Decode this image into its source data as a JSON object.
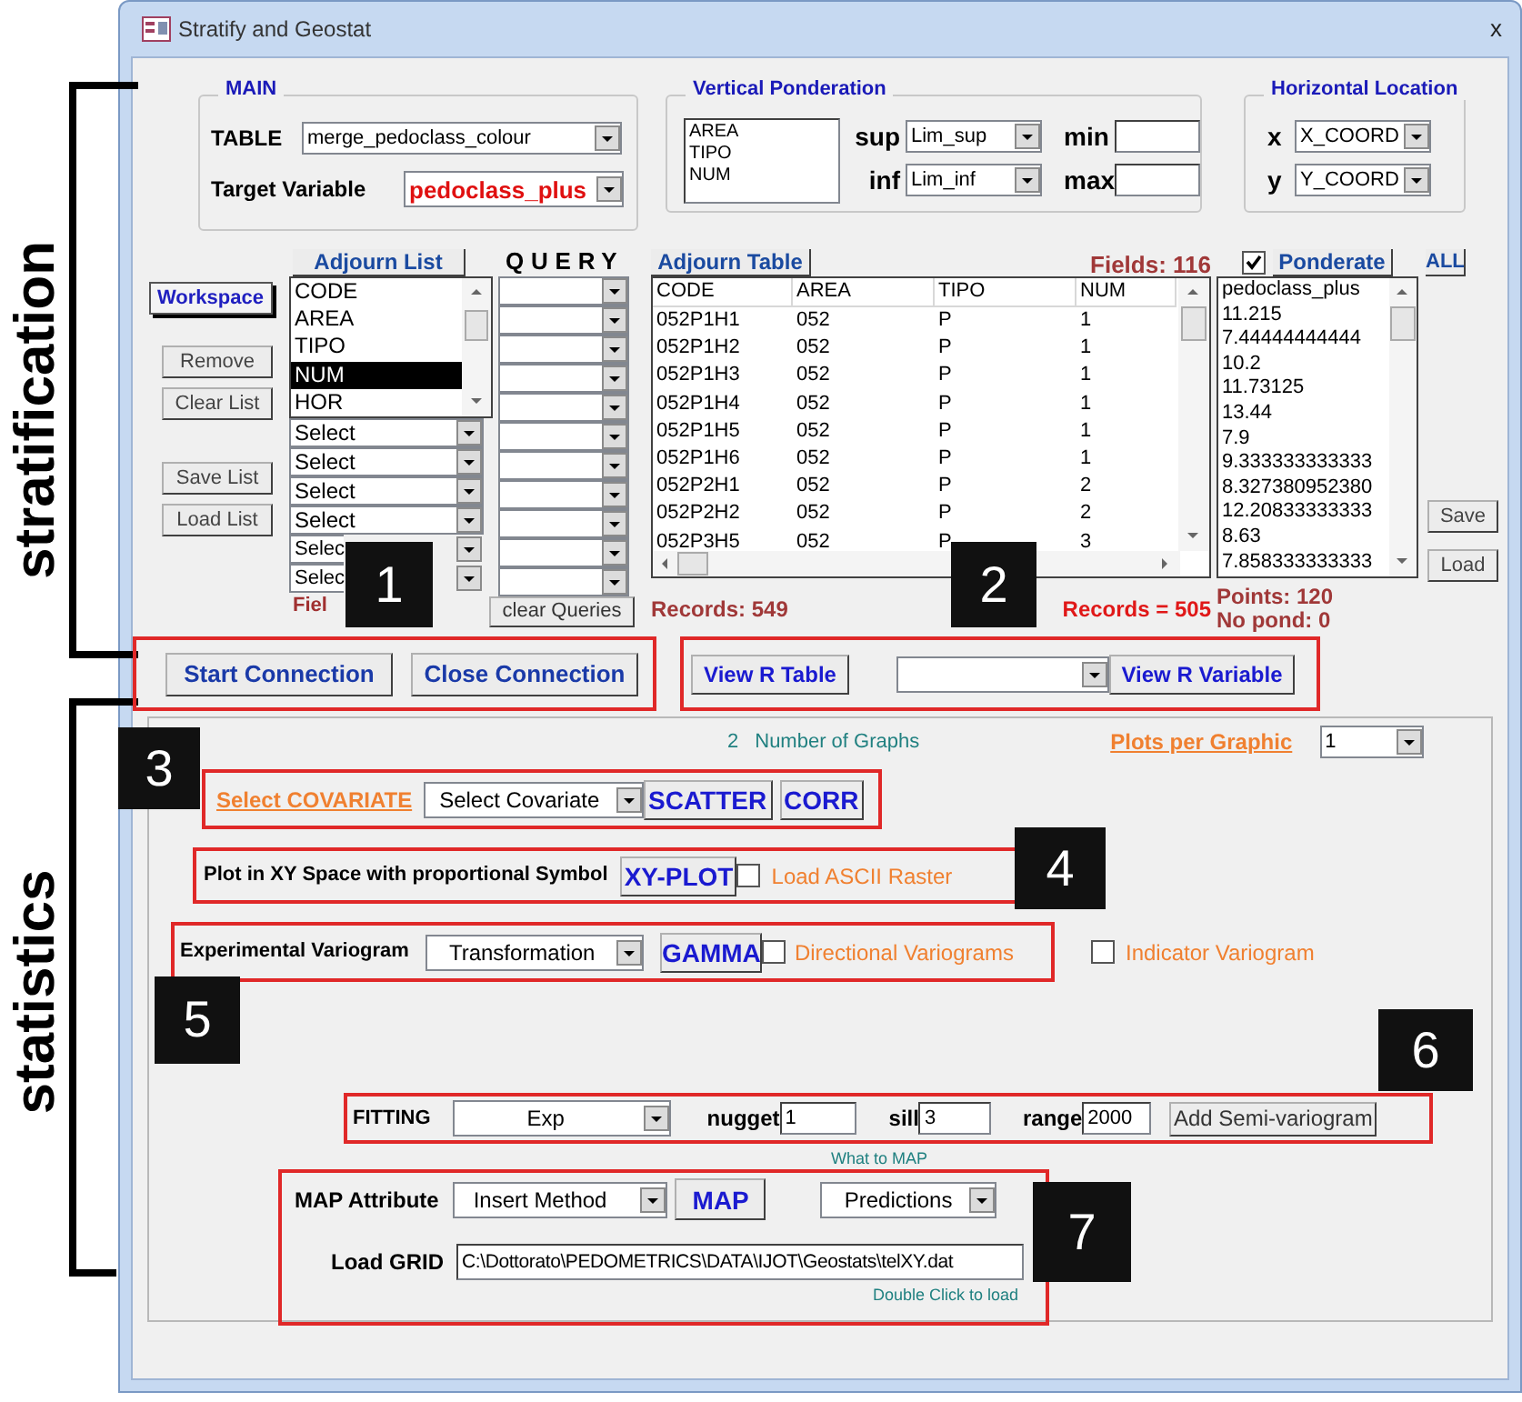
{
  "window": {
    "title": "Stratify and Geostat",
    "close": "x"
  },
  "annotations": {
    "sections": [
      "stratification",
      "statistics"
    ],
    "badges": [
      "1",
      "2",
      "3",
      "4",
      "5",
      "6",
      "7"
    ]
  },
  "main": {
    "title": "MAIN",
    "table_label": "TABLE",
    "table_value": "merge_pedoclass_colour",
    "target_label": "Target Variable",
    "target_value": "pedoclass_plus"
  },
  "vertical_ponderation": {
    "title": "Vertical Ponderation",
    "list": [
      "AREA",
      "TIPO",
      "NUM"
    ],
    "sup_label": "sup",
    "sup_value": "Lim_sup",
    "min_label": "min",
    "inf_label": "inf",
    "inf_value": "Lim_inf",
    "max_label": "max"
  },
  "horizontal_location": {
    "title": "Horizontal Location",
    "x_label": "x",
    "x_value": "X_COORD",
    "y_label": "y",
    "y_value": "Y_COORD"
  },
  "side_buttons": {
    "workspace": "Workspace",
    "actions": [
      "Remove",
      "Clear List"
    ],
    "list_actions": [
      "Save List",
      "Load List"
    ]
  },
  "adjourn_list": {
    "button": "Adjourn List",
    "items": [
      {
        "label": "CODE",
        "selected": false
      },
      {
        "label": "AREA",
        "selected": false
      },
      {
        "label": "TIPO",
        "selected": false
      },
      {
        "label": "NUM",
        "selected": true
      },
      {
        "label": "HOR",
        "selected": false
      }
    ],
    "selects": [
      "Select",
      "Select",
      "Select",
      "Select",
      "Selec",
      "Selec"
    ],
    "footer": "Fiel"
  },
  "query": {
    "title": "QUERY",
    "button": "clear Queries"
  },
  "adjourn_table": {
    "button": "Adjourn Table",
    "fields": "Fields: 116",
    "columns": [
      "CODE",
      "AREA",
      "TIPO",
      "NUM"
    ],
    "rows": [
      [
        "052P1H1",
        "052",
        "P",
        "1"
      ],
      [
        "052P1H2",
        "052",
        "P",
        "1"
      ],
      [
        "052P1H3",
        "052",
        "P",
        "1"
      ],
      [
        "052P1H4",
        "052",
        "P",
        "1"
      ],
      [
        "052P1H5",
        "052",
        "P",
        "1"
      ],
      [
        "052P1H6",
        "052",
        "P",
        "1"
      ],
      [
        "052P2H1",
        "052",
        "P",
        "2"
      ],
      [
        "052P2H2",
        "052",
        "P",
        "2"
      ],
      [
        "052P3H5",
        "052",
        "P",
        "3"
      ]
    ],
    "records": "Records: 549",
    "filtered_records": "Records = 505"
  },
  "ponderate": {
    "checked": true,
    "button": "Ponderate",
    "all": "ALL",
    "header": "pedoclass_plus",
    "values": [
      "11.215",
      "7.44444444444",
      "10.2",
      "11.73125",
      "13.44",
      "7.9",
      "9.333333333333",
      "8.327380952380",
      "12.20833333333",
      "8.63",
      "7.858333333333"
    ],
    "points": "Points: 120",
    "no_pond": "No pond: 0",
    "save": "Save",
    "load": "Load"
  },
  "connection": {
    "start": "Start Connection",
    "close": "Close Connection"
  },
  "r_view": {
    "table": "View R Table",
    "variable": "View R Variable"
  },
  "graphs": {
    "count": "2",
    "label": "Number of Graphs",
    "plots_label": "Plots per Graphic",
    "plots_value": "1"
  },
  "covariate": {
    "label": "Select COVARIATE",
    "value": "Select Covariate",
    "scatter": "SCATTER",
    "corr": "CORR"
  },
  "xy_plot": {
    "label": "Plot in XY Space with proportional Symbol",
    "button": "XY-PLOT",
    "raster_label": "Load ASCII Raster",
    "raster_checked": false
  },
  "variogram": {
    "label": "Experimental Variogram",
    "value": "Transformation",
    "button": "GAMMA",
    "directional_label": "Directional Variograms",
    "directional_checked": false,
    "indicator_label": "Indicator Variogram",
    "indicator_checked": false
  },
  "fitting": {
    "label": "FITTING",
    "model": "Exp",
    "nugget_label": "nugget",
    "nugget": "1",
    "sill_label": "sill",
    "sill": "3",
    "range_label": "range",
    "range": "2000",
    "button": "Add Semi-variogram"
  },
  "map": {
    "hint": "What to MAP",
    "label": "MAP Attribute",
    "method": "Insert Method",
    "button": "MAP",
    "output": "Predictions",
    "grid_label": "Load GRID",
    "grid_path": "C:\\Dottorato\\PEDOMETRICS\\DATA\\IJOT\\Geostats\\telXY.dat",
    "grid_hint": "Double Click to load"
  }
}
